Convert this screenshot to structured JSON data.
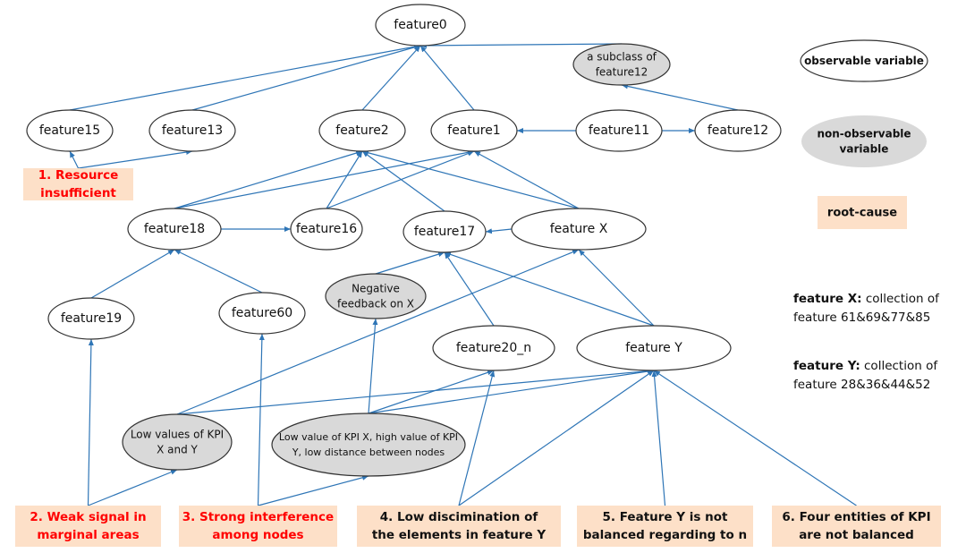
{
  "colors": {
    "edge": "#2e75b6",
    "root_fill": "#fde0c8",
    "root_text_red": "#ff0000",
    "hidden_fill": "#d9d9d9",
    "outline": "#333333"
  },
  "nodes": {
    "feature0": {
      "label": "feature0",
      "kind": "observable"
    },
    "subclass": {
      "label": "a subclass of feature12",
      "kind": "hidden"
    },
    "feature15": {
      "label": "feature15",
      "kind": "observable"
    },
    "feature13": {
      "label": "feature13",
      "kind": "observable"
    },
    "feature2": {
      "label": "feature2",
      "kind": "observable"
    },
    "feature1": {
      "label": "feature1",
      "kind": "observable"
    },
    "feature11": {
      "label": "feature11",
      "kind": "observable"
    },
    "feature12": {
      "label": "feature12",
      "kind": "observable"
    },
    "feature18": {
      "label": "feature18",
      "kind": "observable"
    },
    "feature16": {
      "label": "feature16",
      "kind": "observable"
    },
    "feature17": {
      "label": "feature17",
      "kind": "observable"
    },
    "featureX": {
      "label": "feature X",
      "kind": "observable"
    },
    "feature19": {
      "label": "feature19",
      "kind": "observable"
    },
    "feature60": {
      "label": "feature60",
      "kind": "observable"
    },
    "negfb": {
      "label": "Negative feedback on X",
      "kind": "hidden"
    },
    "feature20n": {
      "label": "feature20_n",
      "kind": "observable"
    },
    "featureY": {
      "label": "feature Y",
      "kind": "observable"
    },
    "lowkpi": {
      "label": "Low values of KPI X and Y",
      "kind": "hidden"
    },
    "lowhigh": {
      "label": "Low value of KPI X, high value of KPI Y, low distance between nodes",
      "kind": "hidden"
    },
    "root1": {
      "label": "1. Resource insufficient",
      "kind": "root",
      "red": true
    },
    "root2": {
      "label": "2. Weak signal in marginal areas",
      "kind": "root",
      "red": true
    },
    "root3": {
      "label": "3. Strong interference among nodes",
      "kind": "root",
      "red": true
    },
    "root4": {
      "label": "4. Low discimination of the elements in feature Y",
      "kind": "root",
      "red": false
    },
    "root5": {
      "label": "5. Feature Y is not balanced regarding to n",
      "kind": "root",
      "red": false
    },
    "root6": {
      "label": "6. Four entities of KPI are not balanced",
      "kind": "root",
      "red": false
    }
  },
  "edges": [
    [
      "feature15",
      "feature0"
    ],
    [
      "feature13",
      "feature0"
    ],
    [
      "feature2",
      "feature0"
    ],
    [
      "feature1",
      "feature0"
    ],
    [
      "subclass",
      "feature0"
    ],
    [
      "feature12",
      "subclass"
    ],
    [
      "feature11",
      "feature1"
    ],
    [
      "feature11",
      "feature12"
    ],
    [
      "root1",
      "feature15"
    ],
    [
      "root1",
      "feature13"
    ],
    [
      "feature18",
      "feature2"
    ],
    [
      "feature18",
      "feature1"
    ],
    [
      "feature18",
      "feature16"
    ],
    [
      "feature16",
      "feature2"
    ],
    [
      "feature16",
      "feature1"
    ],
    [
      "feature17",
      "feature2"
    ],
    [
      "featureX",
      "feature2"
    ],
    [
      "featureX",
      "feature1"
    ],
    [
      "featureX",
      "feature17"
    ],
    [
      "feature19",
      "feature18"
    ],
    [
      "feature60",
      "feature18"
    ],
    [
      "negfb",
      "feature17"
    ],
    [
      "lowhigh",
      "negfb"
    ],
    [
      "lowkpi",
      "featureX"
    ],
    [
      "featureY",
      "featureX"
    ],
    [
      "featureY",
      "feature17"
    ],
    [
      "feature20n",
      "feature17"
    ],
    [
      "lowkpi",
      "featureY"
    ],
    [
      "lowhigh",
      "featureY"
    ],
    [
      "lowhigh",
      "feature20n"
    ],
    [
      "root2",
      "feature19"
    ],
    [
      "root2",
      "lowkpi"
    ],
    [
      "root3",
      "feature60"
    ],
    [
      "root3",
      "lowhigh"
    ],
    [
      "root4",
      "feature20n"
    ],
    [
      "root4",
      "featureY"
    ],
    [
      "root5",
      "featureY"
    ],
    [
      "root6",
      "featureY"
    ]
  ],
  "legend": {
    "observable": "observable variable",
    "hidden": "non-observable variable",
    "root": "root-cause"
  },
  "notes": [
    {
      "term": "feature X:",
      "text": " collection of feature 61&69&77&85"
    },
    {
      "term": "feature Y:",
      "text": " collection of feature 28&36&44&52"
    }
  ]
}
